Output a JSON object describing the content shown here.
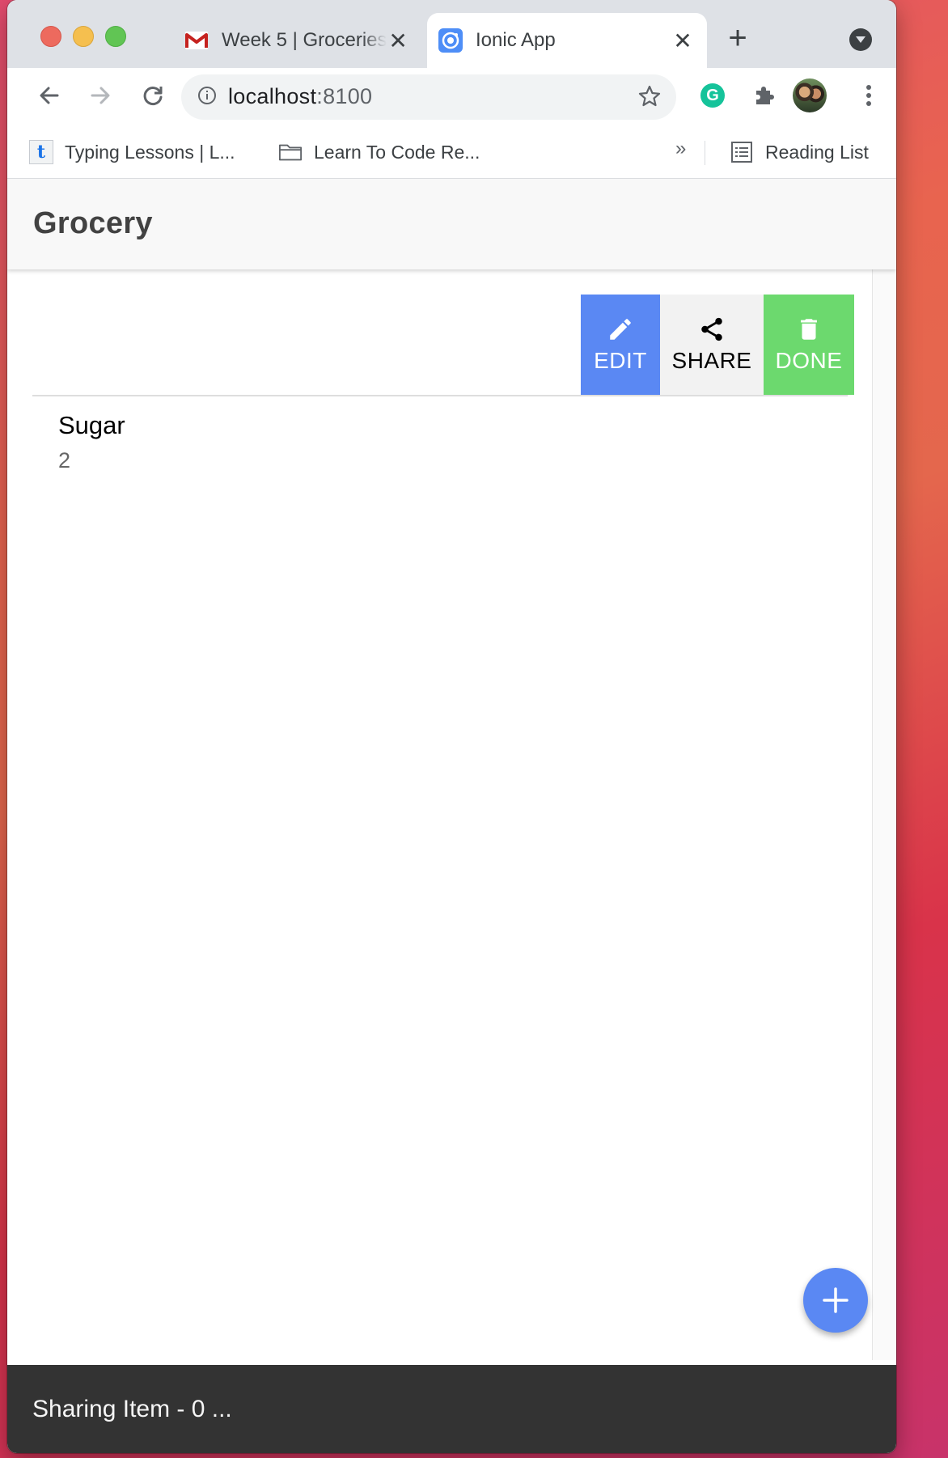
{
  "browser": {
    "tabs": [
      {
        "title": "Week 5 | Groceries",
        "favicon": "gmail-icon",
        "active": false
      },
      {
        "title": "Ionic App",
        "favicon": "ionic-icon",
        "active": true
      }
    ],
    "close_glyph": "✕",
    "new_tab_glyph": "+",
    "address": {
      "host": "localhost",
      "port": ":8100"
    },
    "bookmarks": [
      {
        "label": "Typing Lessons | L...",
        "icon": "typing-t-icon"
      },
      {
        "label": "Learn To Code Re...",
        "icon": "folder-icon"
      }
    ],
    "bookmarks_overflow": "»",
    "reading_list_label": "Reading List",
    "grammarly_letter": "G"
  },
  "app": {
    "title": "Grocery",
    "item_options": [
      {
        "label": "EDIT",
        "icon": "pencil-icon",
        "color": "#5a88f3"
      },
      {
        "label": "SHARE",
        "icon": "share-icon",
        "color": "#f2f2f2"
      },
      {
        "label": "DONE",
        "icon": "trash-icon",
        "color": "#6cd96e"
      }
    ],
    "items": [
      {
        "name": "Sugar",
        "quantity": "2"
      }
    ],
    "fab_icon": "add-icon",
    "toast_message": "Sharing Item - 0 ..."
  },
  "colors": {
    "primary": "#5a88f3",
    "success": "#6cd96e",
    "toast_bg": "#333333",
    "header_bg": "#f8f8f8"
  }
}
